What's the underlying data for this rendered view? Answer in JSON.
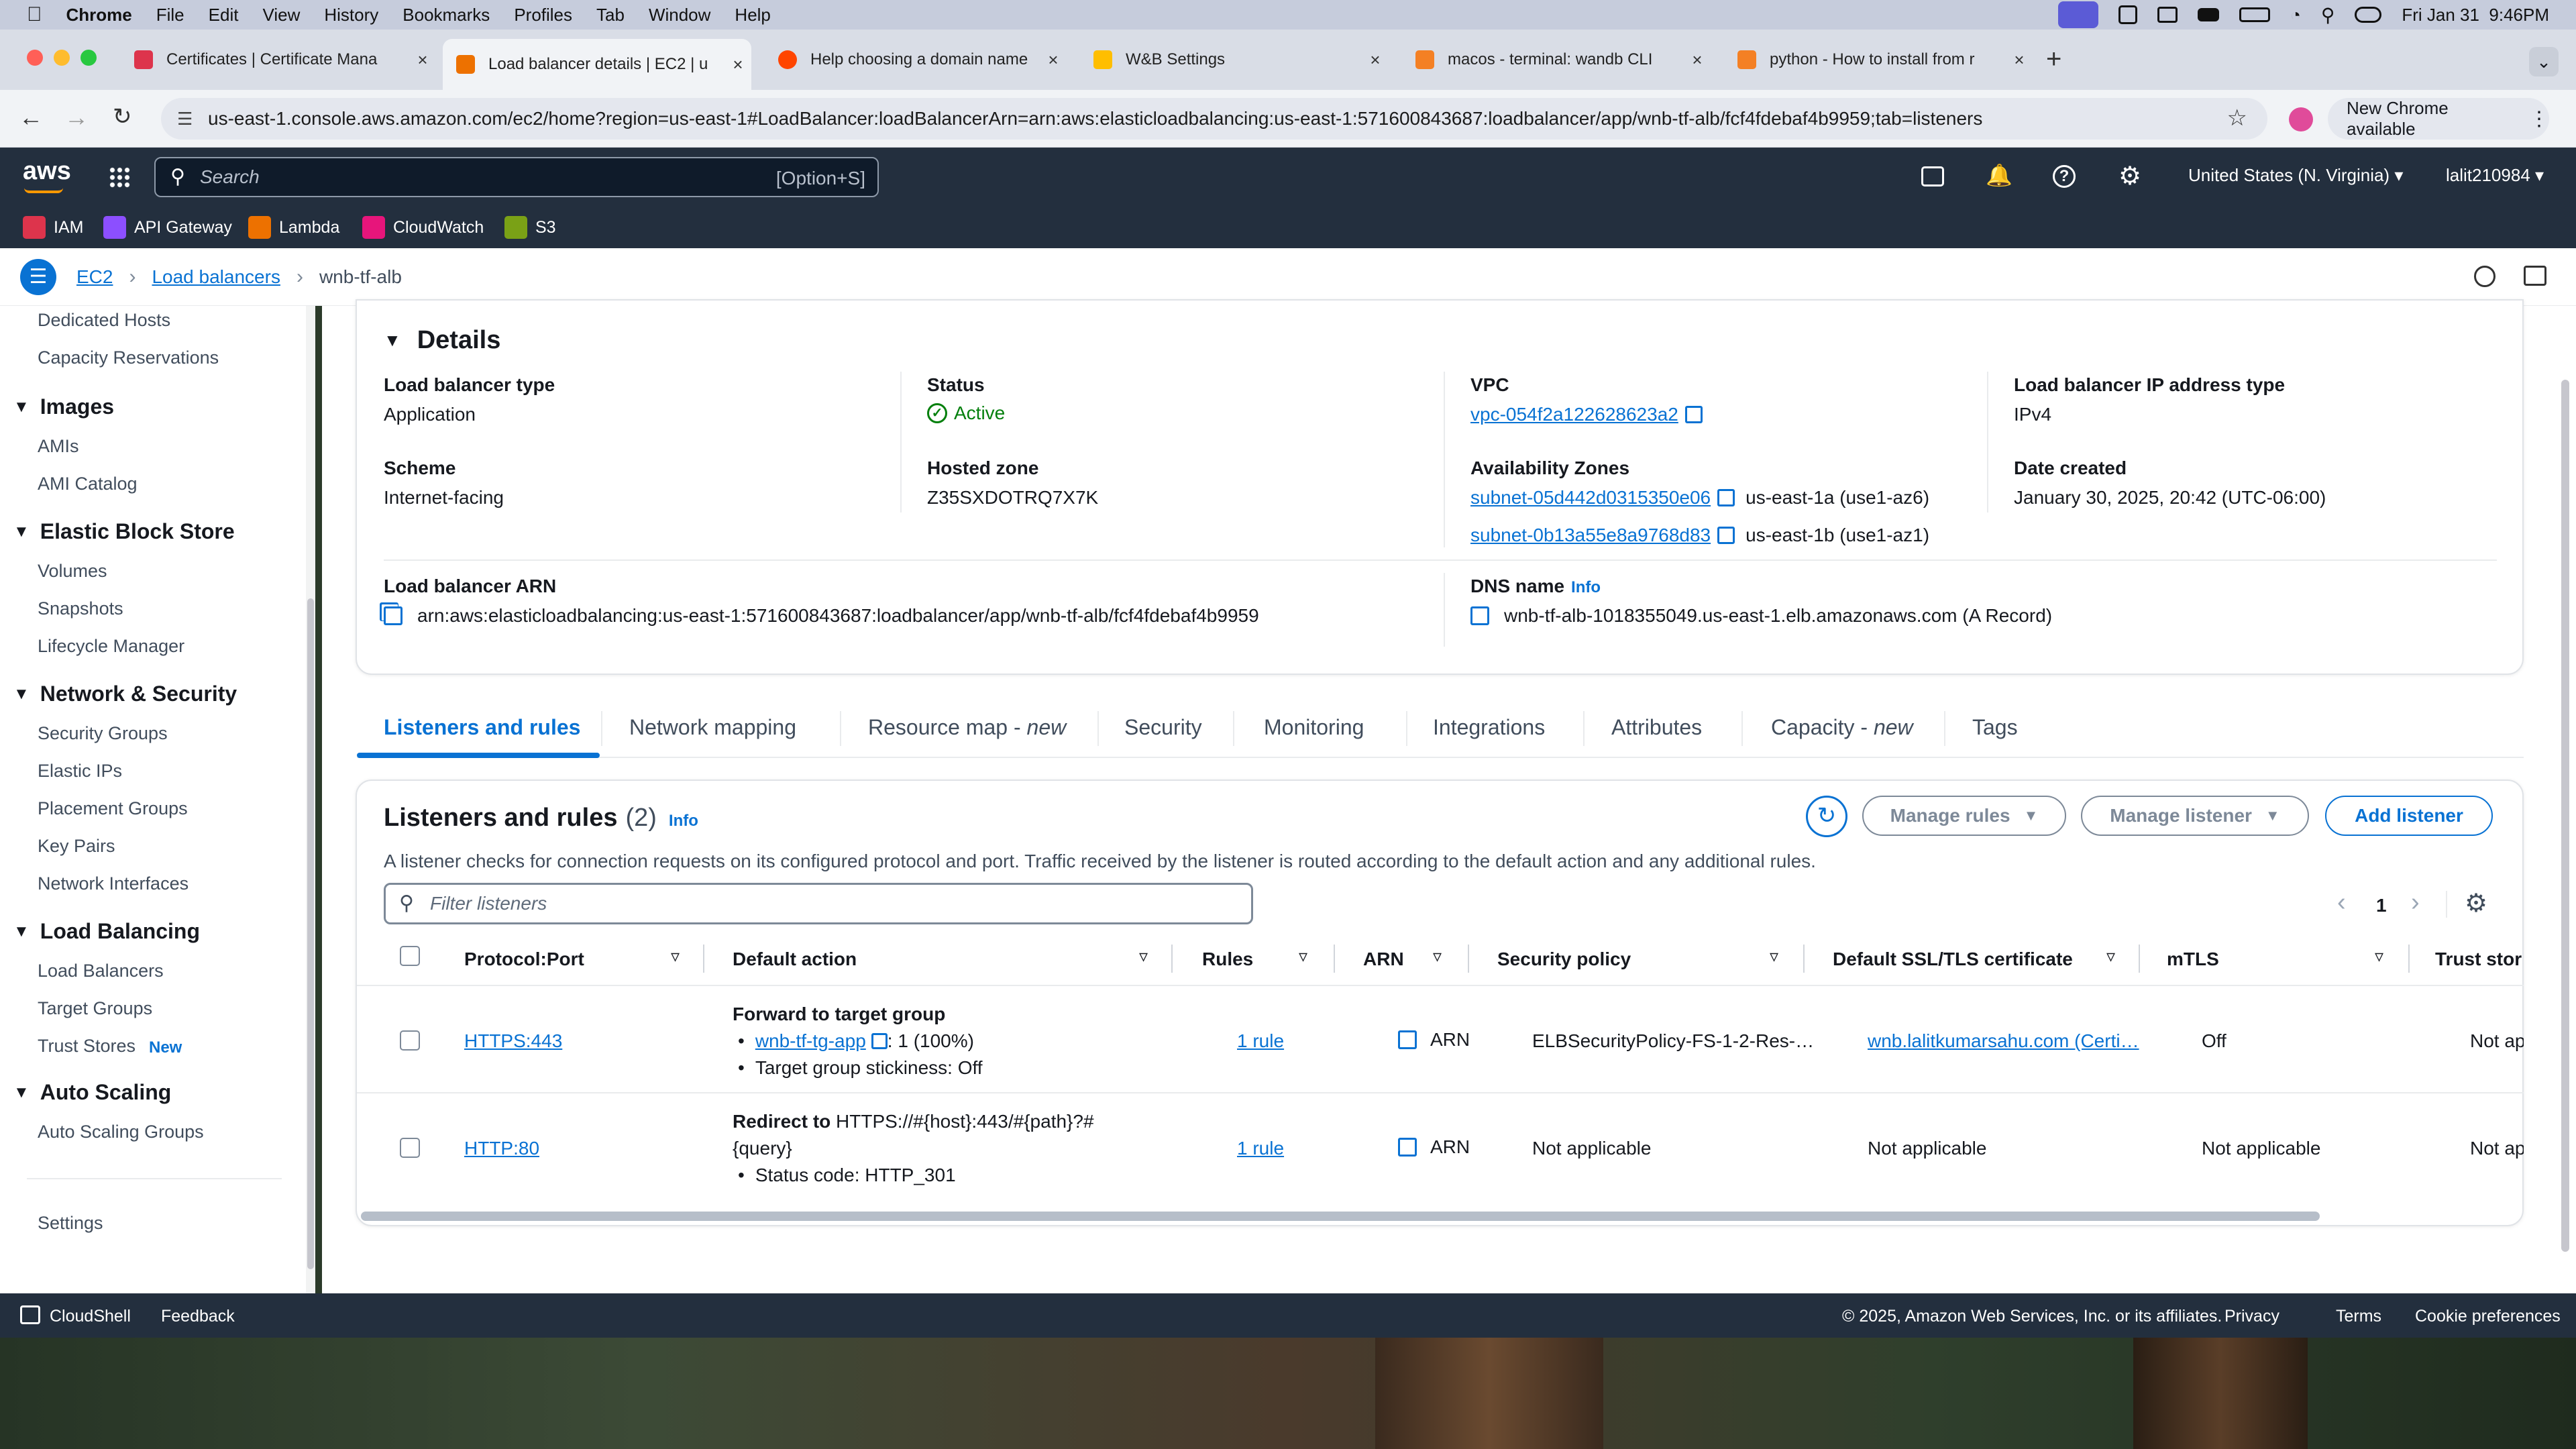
{
  "menubar": {
    "app": "Chrome",
    "items": [
      "File",
      "Edit",
      "View",
      "History",
      "Bookmarks",
      "Profiles",
      "Tab",
      "Window",
      "Help"
    ],
    "datetime": "Fri Jan 31  9:46PM"
  },
  "tabs": [
    {
      "title": "Certificates | Certificate Mana",
      "color": "#dd344c"
    },
    {
      "title": "Load balancer details | EC2 | u",
      "color": "#ed7100"
    },
    {
      "title": "Help choosing a domain name",
      "color": "#ff4500"
    },
    {
      "title": "W&B Settings",
      "color": "#ffbe00"
    },
    {
      "title": "macos - terminal: wandb CLI",
      "color": "#f48024"
    },
    {
      "title": "python - How to install from r",
      "color": "#f48024"
    }
  ],
  "browser": {
    "url": "us-east-1.console.aws.amazon.com/ec2/home?region=us-east-1#LoadBalancer:loadBalancerArn=arn:aws:elasticloadbalancing:us-east-1:571600843687:loadbalancer/app/wnb-tf-alb/fcf4fdebaf4b9959;tab=listeners",
    "new_chrome": "New Chrome available"
  },
  "aws": {
    "logo": "aws",
    "search_placeholder": "Search",
    "search_shortcut": "[Option+S]",
    "region": "United States (N. Virginia)",
    "account": "lalit210984",
    "favorites": [
      {
        "label": "IAM",
        "color": "#dd344c"
      },
      {
        "label": "API Gateway",
        "color": "#8c4fff"
      },
      {
        "label": "Lambda",
        "color": "#ed7100"
      },
      {
        "label": "CloudWatch",
        "color": "#e7157b"
      },
      {
        "label": "S3",
        "color": "#7aa116"
      }
    ]
  },
  "breadcrumb": [
    "EC2",
    "Load balancers",
    "wnb-tf-alb"
  ],
  "sidebar": {
    "top_items": [
      "Dedicated Hosts",
      "Capacity Reservations"
    ],
    "sections": [
      {
        "title": "Images",
        "items": [
          "AMIs",
          "AMI Catalog"
        ]
      },
      {
        "title": "Elastic Block Store",
        "items": [
          "Volumes",
          "Snapshots",
          "Lifecycle Manager"
        ]
      },
      {
        "title": "Network & Security",
        "items": [
          "Security Groups",
          "Elastic IPs",
          "Placement Groups",
          "Key Pairs",
          "Network Interfaces"
        ]
      },
      {
        "title": "Load Balancing",
        "items": [
          "Load Balancers",
          "Target Groups",
          "Trust Stores"
        ]
      },
      {
        "title": "Auto Scaling",
        "items": [
          "Auto Scaling Groups"
        ]
      }
    ],
    "new_badge": "New",
    "settings": "Settings"
  },
  "details": {
    "title": "Details",
    "lb_type_label": "Load balancer type",
    "lb_type": "Application",
    "status_label": "Status",
    "status": "Active",
    "vpc_label": "VPC",
    "vpc": "vpc-054f2a122628623a2",
    "ip_type_label": "Load balancer IP address type",
    "ip_type": "IPv4",
    "scheme_label": "Scheme",
    "scheme": "Internet-facing",
    "zone_label": "Hosted zone",
    "zone": "Z35SXDOTRQ7X7K",
    "az_label": "Availability Zones",
    "az": [
      {
        "subnet": "subnet-05d442d0315350e06",
        "zone": "us-east-1a (use1-az6)"
      },
      {
        "subnet": "subnet-0b13a55e8a9768d83",
        "zone": "us-east-1b (use1-az1)"
      }
    ],
    "date_label": "Date created",
    "date": "January 30, 2025, 20:42 (UTC-06:00)",
    "arn_label": "Load balancer ARN",
    "arn": "arn:aws:elasticloadbalancing:us-east-1:571600843687:loadbalancer/app/wnb-tf-alb/fcf4fdebaf4b9959",
    "dns_label": "DNS name",
    "dns_info": "Info",
    "dns": "wnb-tf-alb-1018355049.us-east-1.elb.amazonaws.com (A Record)"
  },
  "content_tabs": [
    {
      "label": "Listeners and rules",
      "suffix": ""
    },
    {
      "label": "Network mapping",
      "suffix": ""
    },
    {
      "label": "Resource map - ",
      "suffix": "new"
    },
    {
      "label": "Security",
      "suffix": ""
    },
    {
      "label": "Monitoring",
      "suffix": ""
    },
    {
      "label": "Integrations",
      "suffix": ""
    },
    {
      "label": "Attributes",
      "suffix": ""
    },
    {
      "label": "Capacity - ",
      "suffix": "new"
    },
    {
      "label": "Tags",
      "suffix": ""
    }
  ],
  "listeners": {
    "title": "Listeners and rules",
    "count": "(2)",
    "info": "Info",
    "description": "A listener checks for connection requests on its configured protocol and port. Traffic received by the listener is routed according to the default action and any additional rules.",
    "manage_rules": "Manage rules",
    "manage_listener": "Manage listener",
    "add_listener": "Add listener",
    "filter_placeholder": "Filter listeners",
    "page": "1",
    "columns": [
      "Protocol:Port",
      "Default action",
      "Rules",
      "ARN",
      "Security policy",
      "Default SSL/TLS certificate",
      "mTLS",
      "Trust stor"
    ],
    "rows": [
      {
        "protocol": "HTTPS:443",
        "action_title": "Forward to target group",
        "action_link": "wnb-tf-tg-app",
        "action_weight": ": 1 (100%)",
        "action_detail": "Target group stickiness: Off",
        "rules": "1 rule",
        "arn": "ARN",
        "policy": "ELBSecurityPolicy-FS-1-2-Res-…",
        "cert": "wnb.lalitkumarsahu.com (Certi…",
        "mtls": "Off",
        "trust": "Not applic"
      },
      {
        "protocol": "HTTP:80",
        "action_title": "Redirect to",
        "action_line1": " HTTPS://#{host}:443/#{path}?#",
        "action_line2": "{query}",
        "action_detail": "Status code: HTTP_301",
        "rules": "1 rule",
        "arn": "ARN",
        "policy": "Not applicable",
        "cert": "Not applicable",
        "mtls": "Not applicable",
        "trust": "Not applic"
      }
    ]
  },
  "footer": {
    "cloudshell": "CloudShell",
    "feedback": "Feedback",
    "copyright": "© 2025, Amazon Web Services, Inc. or its affiliates.",
    "privacy": "Privacy",
    "terms": "Terms",
    "cookies": "Cookie preferences"
  },
  "colors": {
    "link": "#0972d3",
    "aws_nav": "#232f3e",
    "success": "#037f0c"
  }
}
